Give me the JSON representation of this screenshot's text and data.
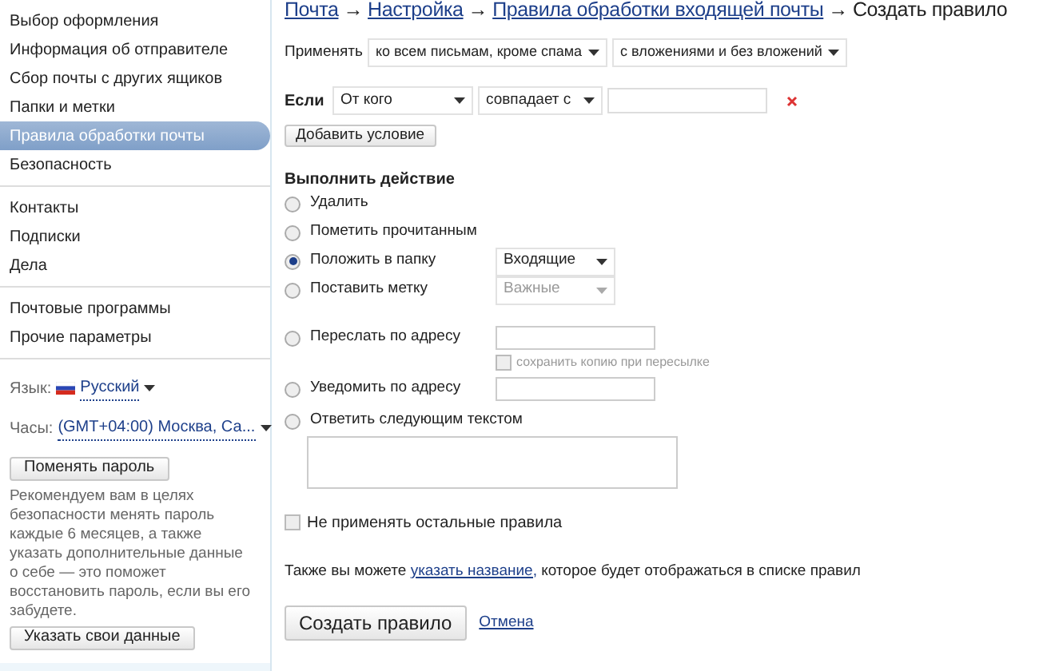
{
  "sidebar": {
    "groups": [
      {
        "items": [
          {
            "label": "Выбор оформления",
            "selected": false
          },
          {
            "label": "Информация об отправителе",
            "selected": false
          },
          {
            "label": "Сбор почты с других ящиков",
            "selected": false
          },
          {
            "label": "Папки и метки",
            "selected": false
          },
          {
            "label": "Правила обработки почты",
            "selected": true
          },
          {
            "label": "Безопасность",
            "selected": false
          }
        ]
      },
      {
        "items": [
          {
            "label": "Контакты",
            "selected": false
          },
          {
            "label": "Подписки",
            "selected": false
          },
          {
            "label": "Дела",
            "selected": false
          }
        ]
      },
      {
        "items": [
          {
            "label": "Почтовые программы",
            "selected": false
          },
          {
            "label": "Прочие параметры",
            "selected": false
          }
        ]
      }
    ],
    "language": {
      "label": "Язык:",
      "value": "Русский"
    },
    "clock": {
      "label": "Часы:",
      "value": "(GMT+04:00) Москва, Са..."
    },
    "change_password_button": "Поменять пароль",
    "advice": "Рекомендуем вам в целях безопасности менять пароль каждые 6 месяцев, а также указать дополнительные данные о себе — это поможет восстановить пароль, если вы его забудете.",
    "details_button": "Указать свои данные"
  },
  "breadcrumb": [
    {
      "kind": "link",
      "text": "Почта"
    },
    {
      "kind": "separator",
      "text": "→"
    },
    {
      "kind": "link",
      "text": "Настройка"
    },
    {
      "kind": "separator",
      "text": "→"
    },
    {
      "kind": "link",
      "text": "Правила обработки входящей почты"
    },
    {
      "kind": "separator",
      "text": "→"
    },
    {
      "kind": "current",
      "text": "Создать правило"
    }
  ],
  "apply": {
    "label": "Применять",
    "scope": "ко всем письмам, кроме спама",
    "attachments": "с вложениями и без вложений"
  },
  "condition": {
    "label": "Если",
    "field": "От кого",
    "operator": "совпадает с"
  },
  "add_condition_button": "Добавить условие",
  "actions_title": "Выполнить действие",
  "actions": [
    {
      "kind": "plain",
      "label": "Удалить",
      "selected": false
    },
    {
      "kind": "plain",
      "label": "Пометить прочитанным",
      "selected": false
    },
    {
      "kind": "select",
      "label": "Положить в папку",
      "selected": true,
      "value": "Входящие",
      "disabled": false
    },
    {
      "kind": "select",
      "label": "Поставить метку",
      "selected": false,
      "value": "Важные",
      "disabled": true
    },
    {
      "kind": "forward",
      "label": "Переслать по адресу",
      "selected": false,
      "copy_label": "сохранить копию при пересылке",
      "copy_checked": false
    },
    {
      "kind": "input",
      "label": "Уведомить по адресу",
      "selected": false
    },
    {
      "kind": "textarea",
      "label": "Ответить следующим текстом",
      "selected": false
    }
  ],
  "stop_rules": {
    "label": "Не применять остальные правила",
    "checked": false
  },
  "name_hint": {
    "before": "Также вы можете",
    "link": "указать название,",
    "after": "которое будет отображаться в списке правил"
  },
  "create_button": "Создать правило",
  "cancel_link": "Отмена"
}
